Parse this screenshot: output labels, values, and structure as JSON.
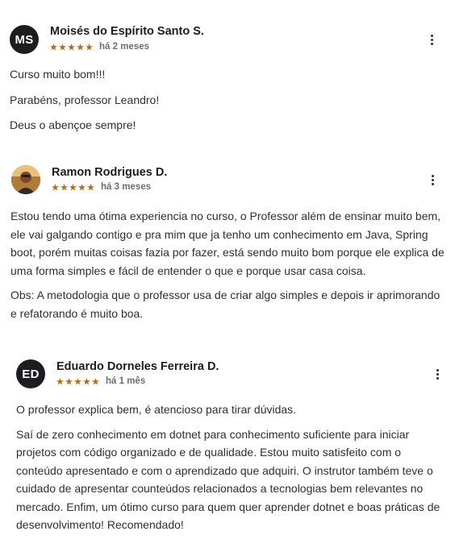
{
  "reviews": [
    {
      "initials": "MS",
      "name": "Moisés do Espírito Santo S.",
      "rating": 5,
      "time": "há 2 meses",
      "paragraphs": [
        "Curso muito bom!!!",
        "Parabéns, professor Leandro!",
        "Deus o abençoe sempre!"
      ]
    },
    {
      "initials": "",
      "name": "Ramon Rodrigues D.",
      "rating": 5,
      "time": "há 3 meses",
      "paragraphs": [
        "Estou tendo uma ótima experiencia no curso, o Professor além de ensinar muito bem, ele vai galgando contigo e pra mim que ja tenho um conhecimento em Java, Spring boot, porém muitas coisas fazia por fazer, está sendo muito bom porque ele explica de uma forma simples e fácil de entender o que e porque usar casa coisa.",
        "Obs: A metodologia que o professor usa de criar algo simples e depois ir aprimorando e refatorando é muito boa."
      ]
    },
    {
      "initials": "ED",
      "name": "Eduardo Dorneles Ferreira D.",
      "rating": 5,
      "time": "há 1 mês",
      "paragraphs": [
        "O professor explica bem, é atencioso para tirar dúvidas.",
        "Saí de zero conhecimento em dotnet para conhecimento suficiente para iniciar projetos com código organizado e de qualidade. Estou muito satisfeito com o conteúdo apresentado e com o aprendizado que adquiri. O instrutor também teve o cuidado de apresentar counteúdos relacionados a tecnologias bem relevantes no mercado. Enfim, um ótimo curso para quem quer aprender dotnet e boas práticas de desenvolvimento! Recomendado!"
      ]
    }
  ],
  "colors": {
    "star": "#b4690e",
    "avatar_bg": "#1c1d1f"
  }
}
